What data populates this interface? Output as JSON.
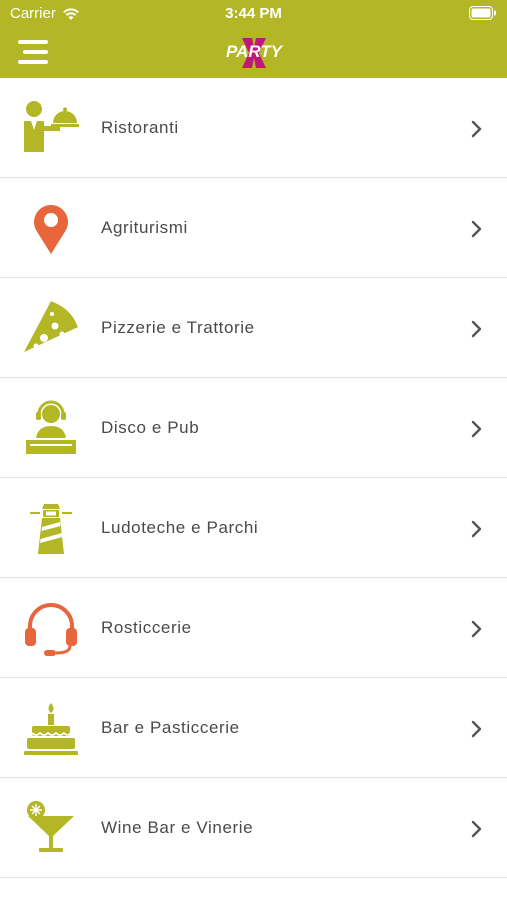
{
  "status_bar": {
    "carrier": "Carrier",
    "time": "3:44 PM"
  },
  "header": {
    "logo_text": "PARTY",
    "logo_mark": "X",
    "brand_color": "#b3b726",
    "logo_color": "#c2177a"
  },
  "categories": [
    {
      "label": "Ristoranti",
      "icon": "waiter-icon",
      "color": "#b3b726"
    },
    {
      "label": "Agriturismi",
      "icon": "map-pin-icon",
      "color": "#e8663c"
    },
    {
      "label": "Pizzerie e Trattorie",
      "icon": "pizza-icon",
      "color": "#b3b726"
    },
    {
      "label": "Disco e Pub",
      "icon": "dj-icon",
      "color": "#b3b726"
    },
    {
      "label": "Ludoteche e Parchi",
      "icon": "lighthouse-icon",
      "color": "#b3b726"
    },
    {
      "label": "Rosticcerie",
      "icon": "headset-icon",
      "color": "#e8663c"
    },
    {
      "label": "Bar e Pasticcerie",
      "icon": "cake-icon",
      "color": "#b3b726"
    },
    {
      "label": "Wine Bar e Vinerie",
      "icon": "cocktail-icon",
      "color": "#b3b726"
    }
  ]
}
